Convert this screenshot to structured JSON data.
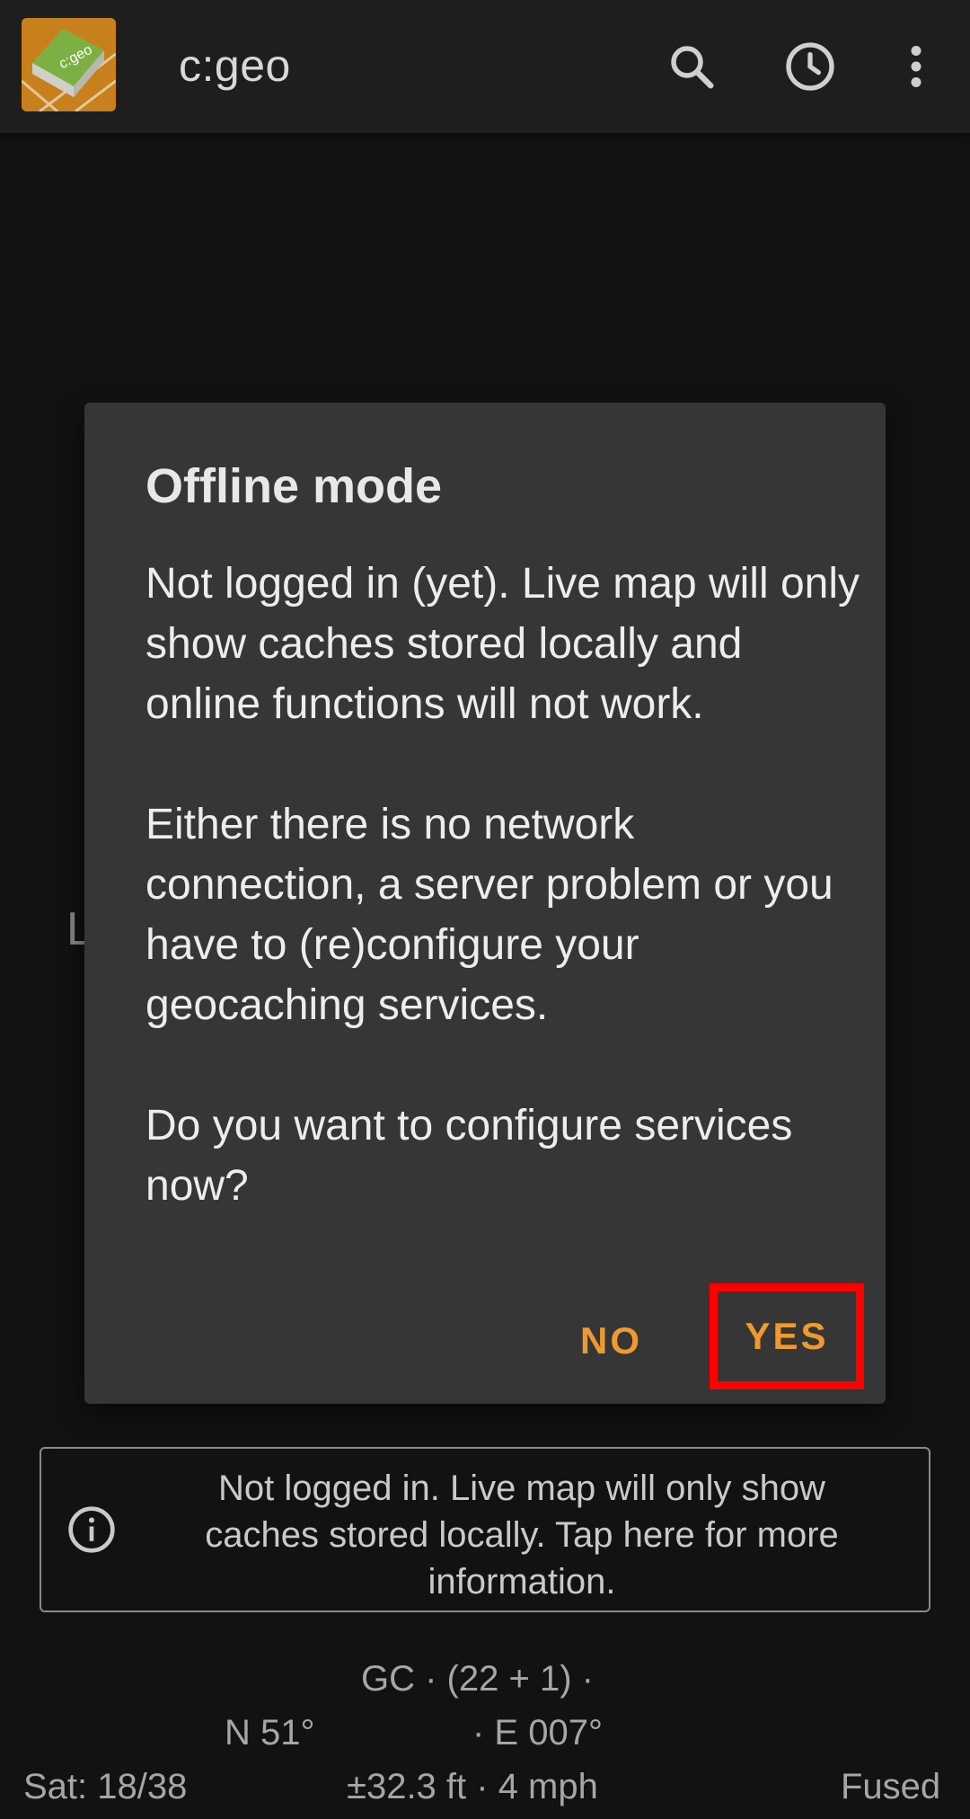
{
  "app": {
    "title": "c:geo",
    "logo_text": "c:geo"
  },
  "appbar": {
    "icons": [
      "search-icon",
      "history-icon",
      "more-vert-icon"
    ]
  },
  "background": {
    "partial_letter": "L"
  },
  "dialog": {
    "title": "Offline mode",
    "message": "Not logged in (yet). Live map will only show caches stored locally and online functions will not work.\n\nEither there is no network connection, a server problem or you have to (re)configure your geocaching services.\n\nDo you want to configure services now?",
    "no_label": "NO",
    "yes_label": "YES"
  },
  "info_banner": {
    "text": "Not logged in. Live map will only show caches stored locally. Tap here for more information."
  },
  "status": {
    "gc_line": "GC · (22 + 1) ·",
    "lat": "N 51°",
    "lon": "· E 007°",
    "satellites": "Sat: 18/38",
    "accuracy_speed": "±32.3 ft · 4 mph",
    "provider": "Fused"
  },
  "colors": {
    "accent": "#ee9a2e",
    "highlight": "#ff0000",
    "dialog_bg": "#363636",
    "appbar_bg": "#1e1e1e"
  }
}
